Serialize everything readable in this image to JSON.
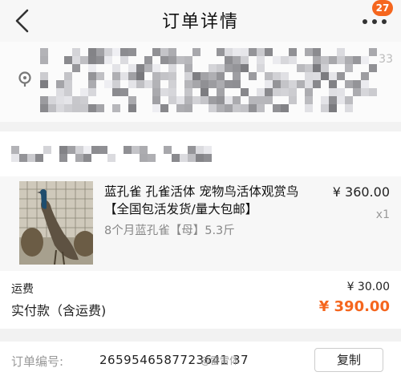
{
  "header": {
    "title": "订单详情",
    "badge_count": "27",
    "back_icon": "chevron-left-icon",
    "more_icon": "more-dots-icon"
  },
  "address": {
    "pin_icon": "location-pin-icon",
    "visible_digits": "33"
  },
  "product": {
    "name": "蓝孔雀 孔雀活体 宠物鸟活体观赏鸟【全国包活发货/量大包邮】",
    "sku": "8个月蓝孔雀【母】5.3斤",
    "price": "¥ 360.00",
    "quantity": "x1"
  },
  "totals": {
    "shipping_label": "运费",
    "shipping_value": "¥ 30.00",
    "paid_label": "实付款（含运费)",
    "paid_value": "¥ 390.00"
  },
  "order": {
    "number_label": "订单编号:",
    "number_value": "2659546587723641 37",
    "copy_label": "复制"
  },
  "watermark": "@雷雷体",
  "colors": {
    "accent": "#f5661e",
    "background": "#f2f2f2"
  }
}
